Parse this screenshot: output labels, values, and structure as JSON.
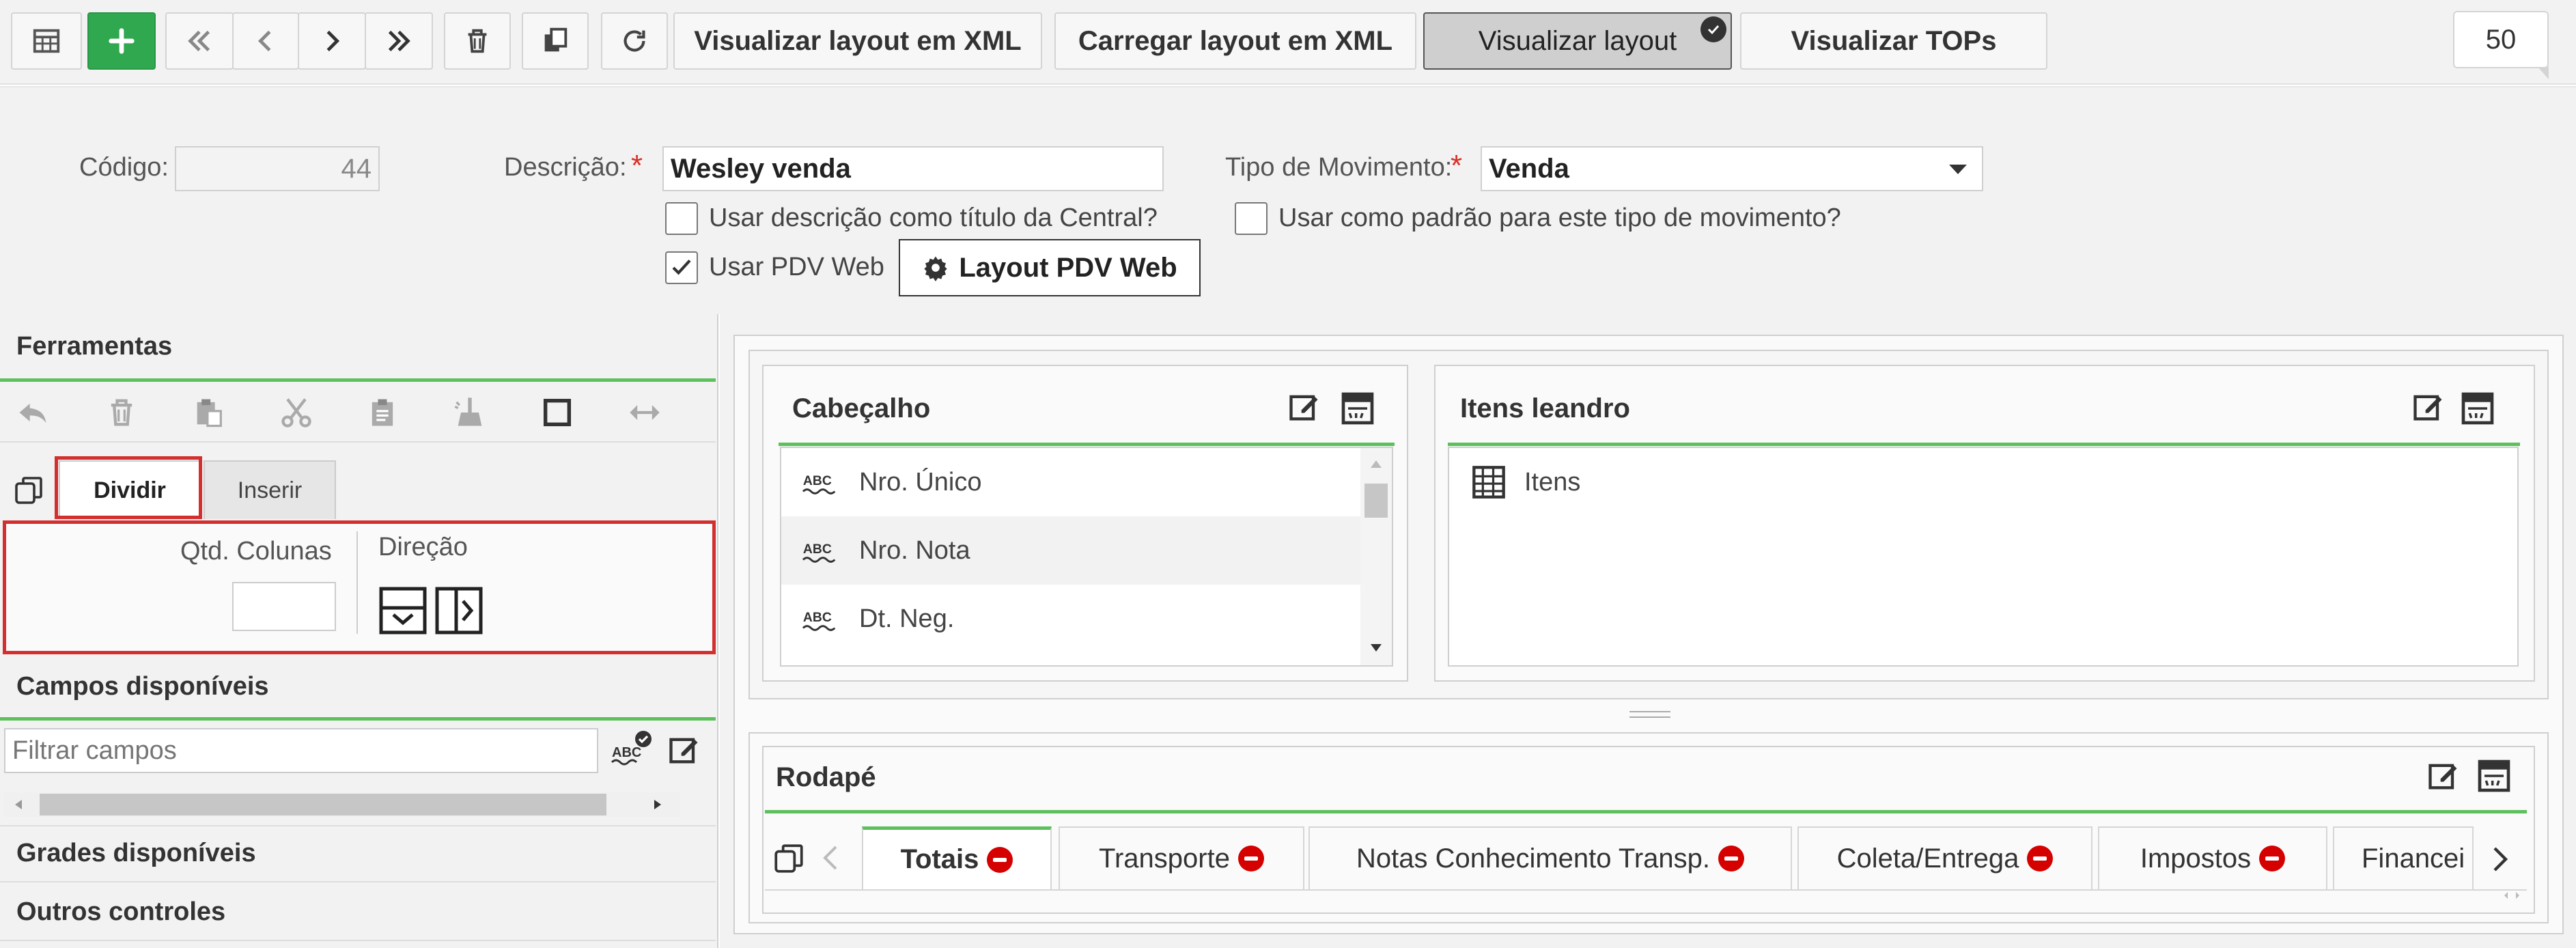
{
  "toolbar": {
    "buttons": [
      "Visualizar layout em XML",
      "Carregar layout em XML",
      "Visualizar layout",
      "Visualizar TOPs"
    ],
    "page_size": "50"
  },
  "form": {
    "codigo_label": "Código:",
    "codigo_value": "44",
    "descricao_label": "Descrição:",
    "descricao_value": "Wesley venda",
    "tipo_label": "Tipo de Movimento:",
    "tipo_value": "Venda",
    "required_mark": "*",
    "chk_usar_descricao": "Usar descrição como título da Central?",
    "chk_usar_padrao": "Usar como padrão para este tipo de movimento?",
    "chk_pdv_web": "Usar PDV Web",
    "btn_layout_pdv": "Layout PDV Web"
  },
  "left": {
    "ferramentas": "Ferramentas",
    "tab_dividir": "Dividir",
    "tab_inserir": "Inserir",
    "qtd_colunas": "Qtd. Colunas",
    "direcao": "Direção",
    "campos": "Campos disponíveis",
    "filtrar_placeholder": "Filtrar campos",
    "grades": "Grades disponíveis",
    "outros": "Outros controles"
  },
  "cabecalho": {
    "title": "Cabeçalho",
    "fields": [
      "Nro. Único",
      "Nro. Nota",
      "Dt. Neg."
    ]
  },
  "itens": {
    "title": "Itens leandro",
    "grid": "Itens"
  },
  "rodape": {
    "title": "Rodapé",
    "tabs": [
      "Totais",
      "Transporte",
      "Notas Conhecimento Transp.",
      "Coleta/Entrega",
      "Impostos",
      "Financei"
    ]
  },
  "colors": {
    "accent_green": "#5cc05c",
    "add_green": "#2fa84f",
    "highlight_red": "#d32f2f",
    "remove_red": "#d50000"
  }
}
